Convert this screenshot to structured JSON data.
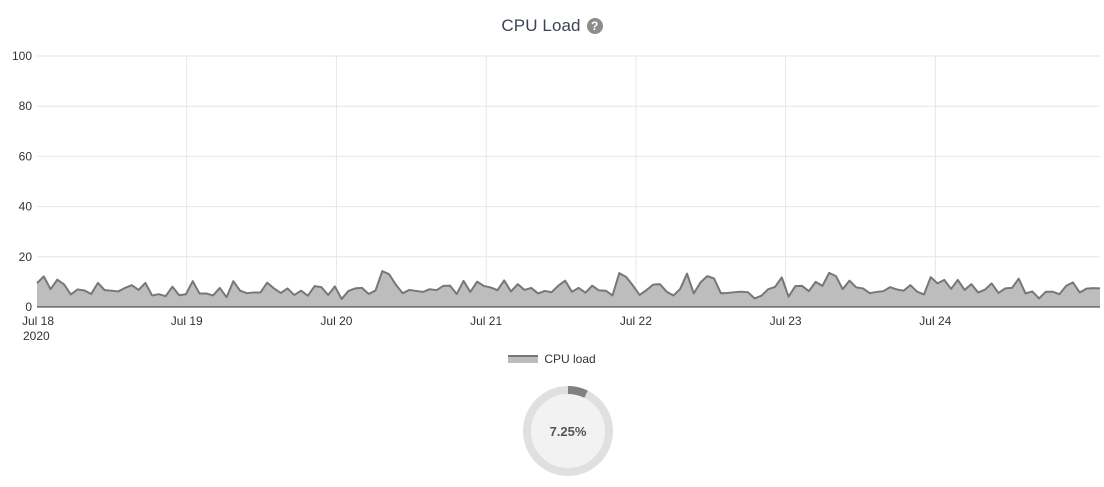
{
  "header": {
    "title": "CPU Load",
    "help_icon": "question-circle-icon",
    "help_glyph": "?"
  },
  "gauge": {
    "value": 7.25,
    "label": "7.25%"
  },
  "colors": {
    "line": "#777777",
    "fill": "#bdbdbd",
    "grid": "#e6e6e6",
    "axis": "#333333",
    "gauge_track": "#e0e0e0",
    "gauge_fill": "#808080",
    "gauge_center": "#f2f2f2"
  },
  "chart_data": {
    "type": "area",
    "title": "CPU Load",
    "xlabel": "",
    "ylabel": "",
    "ylim": [
      0,
      100
    ],
    "xlim": [
      0,
      7.1
    ],
    "grid": true,
    "legend_placement": "bottom-center",
    "y_ticks": [
      "0",
      "20",
      "40",
      "60",
      "80",
      "100"
    ],
    "x_ticks": [
      {
        "x": 0,
        "label": "Jul 18",
        "sublabel": "2020"
      },
      {
        "x": 1,
        "label": "Jul 19",
        "sublabel": ""
      },
      {
        "x": 2,
        "label": "Jul 20",
        "sublabel": ""
      },
      {
        "x": 3,
        "label": "Jul 21",
        "sublabel": ""
      },
      {
        "x": 4,
        "label": "Jul 22",
        "sublabel": ""
      },
      {
        "x": 5,
        "label": "Jul 23",
        "sublabel": ""
      },
      {
        "x": 6,
        "label": "Jul 24",
        "sublabel": ""
      }
    ],
    "series": [
      {
        "name": "CPU load",
        "values": [
          9.5,
          12.2,
          7.1,
          10.9,
          9,
          5,
          7,
          6.6,
          5.2,
          9.6,
          6.7,
          6.5,
          6.2,
          7.6,
          8.7,
          6.8,
          9.6,
          4.6,
          5.1,
          4.3,
          8.1,
          4.7,
          5.1,
          10.3,
          5.4,
          5.4,
          4.6,
          7.6,
          3.9,
          10.3,
          6.5,
          5.5,
          5.8,
          5.8,
          9.7,
          7.4,
          5.6,
          7.4,
          4.8,
          6.5,
          4.5,
          8.3,
          7.9,
          4.8,
          8.2,
          3.2,
          6.4,
          7.4,
          7.6,
          5.2,
          6.6,
          14.3,
          13.1,
          8.9,
          5.5,
          6.8,
          6.4,
          6,
          7.1,
          6.7,
          8.4,
          8.5,
          5.2,
          10.4,
          6,
          10.1,
          8.4,
          7.8,
          6.7,
          10.6,
          6.2,
          9.1,
          6.8,
          7.6,
          5.4,
          6.4,
          5.9,
          8.5,
          10.5,
          6.1,
          7.6,
          5.7,
          8.5,
          6.6,
          6.5,
          4.6,
          13.5,
          12,
          8.6,
          4.8,
          6.7,
          8.9,
          9.1,
          6.1,
          4.6,
          7.2,
          13.3,
          5.4,
          9.8,
          12.3,
          11.4,
          5.5,
          5.6,
          5.9,
          6.1,
          5.9,
          3.4,
          4.5,
          7.1,
          8,
          11.8,
          4.1,
          8.3,
          8.4,
          6.3,
          10,
          8.4,
          13.6,
          12.3,
          7.1,
          10.5,
          7.8,
          7.4,
          5.5,
          6,
          6.3,
          7.9,
          7,
          6.5,
          8.7,
          6.1,
          5,
          11.9,
          9.4,
          10.8,
          7.2,
          10.8,
          6.8,
          9.1,
          5.8,
          6.9,
          9.4,
          5.6,
          7.4,
          7.6,
          11.3,
          5.4,
          6.2,
          3.4,
          6.1,
          6.1,
          5.1,
          8.4,
          9.8,
          5.8,
          7.3,
          7.5,
          7.4
        ]
      }
    ]
  },
  "legend": {
    "label": "CPU load"
  }
}
